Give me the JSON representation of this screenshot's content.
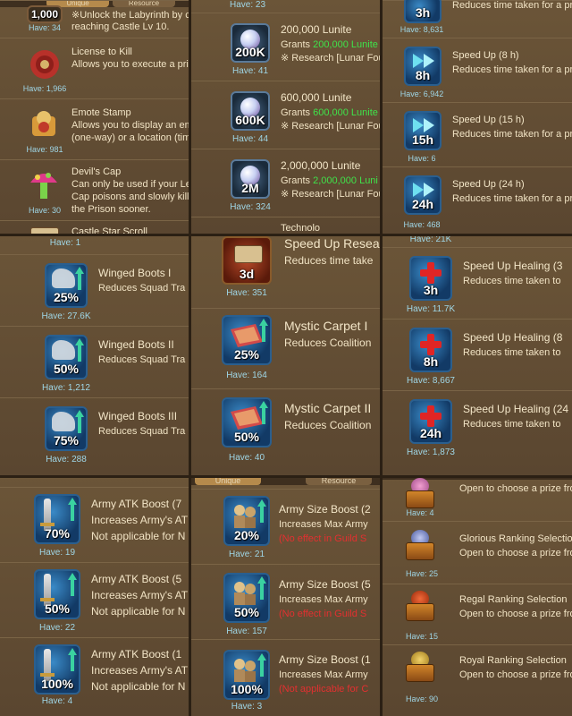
{
  "panel1": {
    "tabs": [
      "Unique",
      "Resource"
    ],
    "top_item": {
      "badge": "1,000",
      "have": "Have: 34",
      "desc1": "※Unlock the Labyrinth by cle",
      "desc2": "reaching Castle Lv 10."
    },
    "items": [
      {
        "title": "License to Kill",
        "desc1": "Allows you to execute a prisc",
        "desc2": "",
        "have": "Have: 1,966",
        "icon": "wax-seal-icon"
      },
      {
        "title": "Emote Stamp",
        "desc1": "Allows you to display an emc",
        "desc2": "(one-way) or a location (time",
        "have": "Have: 981",
        "icon": "stamp-icon"
      },
      {
        "title": "Devil's Cap",
        "desc1": "Can only be used if your Lead",
        "desc2": "Cap poisons and slowly kills y",
        "desc3": "the Prison sooner.",
        "have": "Have: 30",
        "icon": "mushroom-icon"
      }
    ],
    "bottom_title": "Castle Star Scroll"
  },
  "panel2": {
    "top_have": "Have: 23",
    "items": [
      {
        "badge": "200K",
        "title": "200,000 Lunite",
        "grants_prefix": "Grants ",
        "grants_value": "200,000 Lunite",
        "note": "※ Research [Lunar Fou",
        "have": "Have: 41"
      },
      {
        "badge": "600K",
        "title": "600,000 Lunite",
        "grants_prefix": "Grants ",
        "grants_value": "600,000 Lunite",
        "note": "※ Research [Lunar Fou",
        "have": "Have: 44"
      },
      {
        "badge": "2M",
        "title": "2,000,000 Lunite",
        "grants_prefix": "Grants ",
        "grants_value": "2,000,000 Luni",
        "note": "※ Research [Lunar Fou",
        "have": "Have: 324"
      }
    ],
    "bottom_title": "Technolo"
  },
  "panel3": {
    "top": {
      "badge": "3h",
      "desc": "Reduces time taken for a pro",
      "have": "Have: 8,631"
    },
    "items": [
      {
        "badge": "8h",
        "title": "Speed Up (8 h)",
        "desc": "Reduces time taken for a pro",
        "have": "Have: 6,942"
      },
      {
        "badge": "15h",
        "title": "Speed Up (15 h)",
        "desc": "Reduces time taken for a pro",
        "have": "Have: 6"
      },
      {
        "badge": "24h",
        "title": "Speed Up (24 h)",
        "desc": "Reduces time taken for a pro",
        "have": "Have: 468"
      }
    ]
  },
  "panel4": {
    "top_have": "Have: 1",
    "items": [
      {
        "badge": "25%",
        "title": "Winged Boots I",
        "desc": "Reduces Squad Tra",
        "have": "Have: 27.6K"
      },
      {
        "badge": "50%",
        "title": "Winged Boots II",
        "desc": "Reduces Squad Tra",
        "have": "Have: 1,212"
      },
      {
        "badge": "75%",
        "title": "Winged Boots III",
        "desc": "Reduces Squad Tra",
        "have": "Have: 288"
      }
    ]
  },
  "panel5": {
    "items": [
      {
        "badge": "3d",
        "title": "Speed Up Resea",
        "desc": "Reduces time take",
        "have": "Have: 351"
      },
      {
        "badge": "25%",
        "title": "Mystic Carpet I",
        "desc": "Reduces Coalition",
        "have": "Have: 164"
      },
      {
        "badge": "50%",
        "title": "Mystic Carpet II",
        "desc": "Reduces Coalition",
        "have": "Have: 40"
      }
    ]
  },
  "panel6": {
    "top_have": "Have: 21K",
    "items": [
      {
        "badge": "3h",
        "title": "Speed Up Healing (3",
        "desc": "Reduces time taken to",
        "have": "Have: 11.7K"
      },
      {
        "badge": "8h",
        "title": "Speed Up Healing (8",
        "desc": "Reduces time taken to",
        "have": "Have: 8,667"
      },
      {
        "badge": "24h",
        "title": "Speed Up Healing (24",
        "desc": "Reduces time taken to",
        "have": "Have: 1,873"
      }
    ]
  },
  "panel7": {
    "items": [
      {
        "badge": "70%",
        "title": "Army ATK Boost (7",
        "desc1": "Increases Army's AT",
        "desc2": "Not applicable for N",
        "have": "Have: 19"
      },
      {
        "badge": "50%",
        "title": "Army ATK Boost (5",
        "desc1": "Increases Army's AT",
        "desc2": "Not applicable for N",
        "have": "Have: 22"
      },
      {
        "badge": "100%",
        "title": "Army ATK Boost (1",
        "desc1": "Increases Army's AT",
        "desc2": "Not applicable for N",
        "have": "Have: 4"
      }
    ]
  },
  "panel8": {
    "tabs": [
      "Unique",
      "Resource"
    ],
    "items": [
      {
        "badge": "20%",
        "title": "Army Size Boost (2",
        "desc1": "Increases Max Army",
        "desc2": "(No effect in Guild S",
        "have": "Have: 21"
      },
      {
        "badge": "50%",
        "title": "Army Size Boost (5",
        "desc1": "Increases Max Army",
        "desc2": "(No effect in Guild S",
        "have": "Have: 157"
      },
      {
        "badge": "100%",
        "title": "Army Size Boost (1",
        "desc1": "Increases Max Army",
        "desc2": "(Not applicable for C",
        "have": "Have: 3"
      }
    ]
  },
  "panel9": {
    "top": {
      "desc": "Open to choose a prize fron",
      "have": "Have: 4"
    },
    "items": [
      {
        "title": "Glorious Ranking Selectio",
        "desc": "Open to choose a prize fron",
        "have": "Have: 25"
      },
      {
        "title": "Regal Ranking Selection",
        "desc": "Open to choose a prize fron",
        "have": "Have: 15"
      },
      {
        "title": "Royal Ranking Selection",
        "desc": "Open to choose a prize fron",
        "have": "Have: 90"
      }
    ]
  },
  "colors": {
    "grants_green": "#3fe24a",
    "warning_red": "#e23030",
    "have_text": "#9fd6e6",
    "panel_bg": "#6b5538"
  }
}
